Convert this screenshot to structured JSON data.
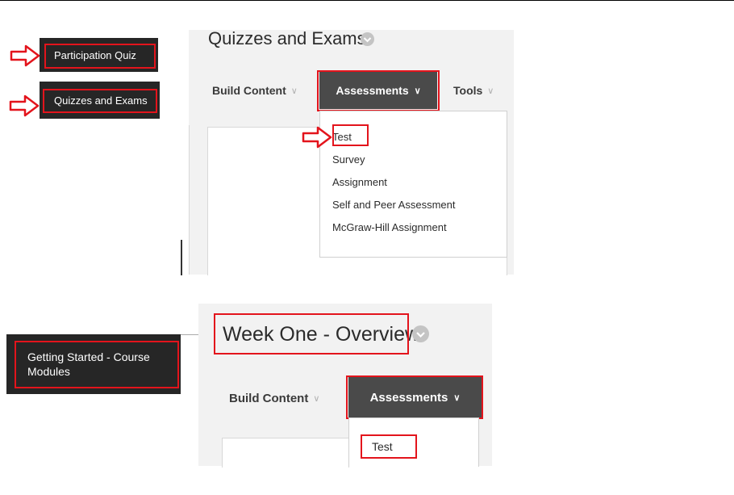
{
  "sidebar_top": {
    "item_1": "Participation Quiz",
    "item_2": "Quizzes and Exams"
  },
  "panel_top": {
    "title": "Quizzes and Exams",
    "build_content": "Build Content",
    "assessments": "Assessments",
    "tools": "Tools",
    "dropdown_items": [
      "Test",
      "Survey",
      "Assignment",
      "Self and Peer Assessment",
      "McGraw-Hill Assignment"
    ]
  },
  "sidebar_bottom": {
    "item_line1": "Getting Started - Course",
    "item_line2": "Modules"
  },
  "panel_bottom": {
    "title": "Week One - Overview",
    "build_content": "Build Content",
    "assessments": "Assessments",
    "dropdown_items": [
      "Test"
    ]
  },
  "icons": {
    "chevron": "chevron-down-icon",
    "arrow": "arrow-right-icon"
  },
  "colors": {
    "highlight": "#e3141c",
    "nav_bg": "#262626",
    "assess_bg": "#4a4a4a",
    "panel_bg": "#f2f2f2"
  }
}
